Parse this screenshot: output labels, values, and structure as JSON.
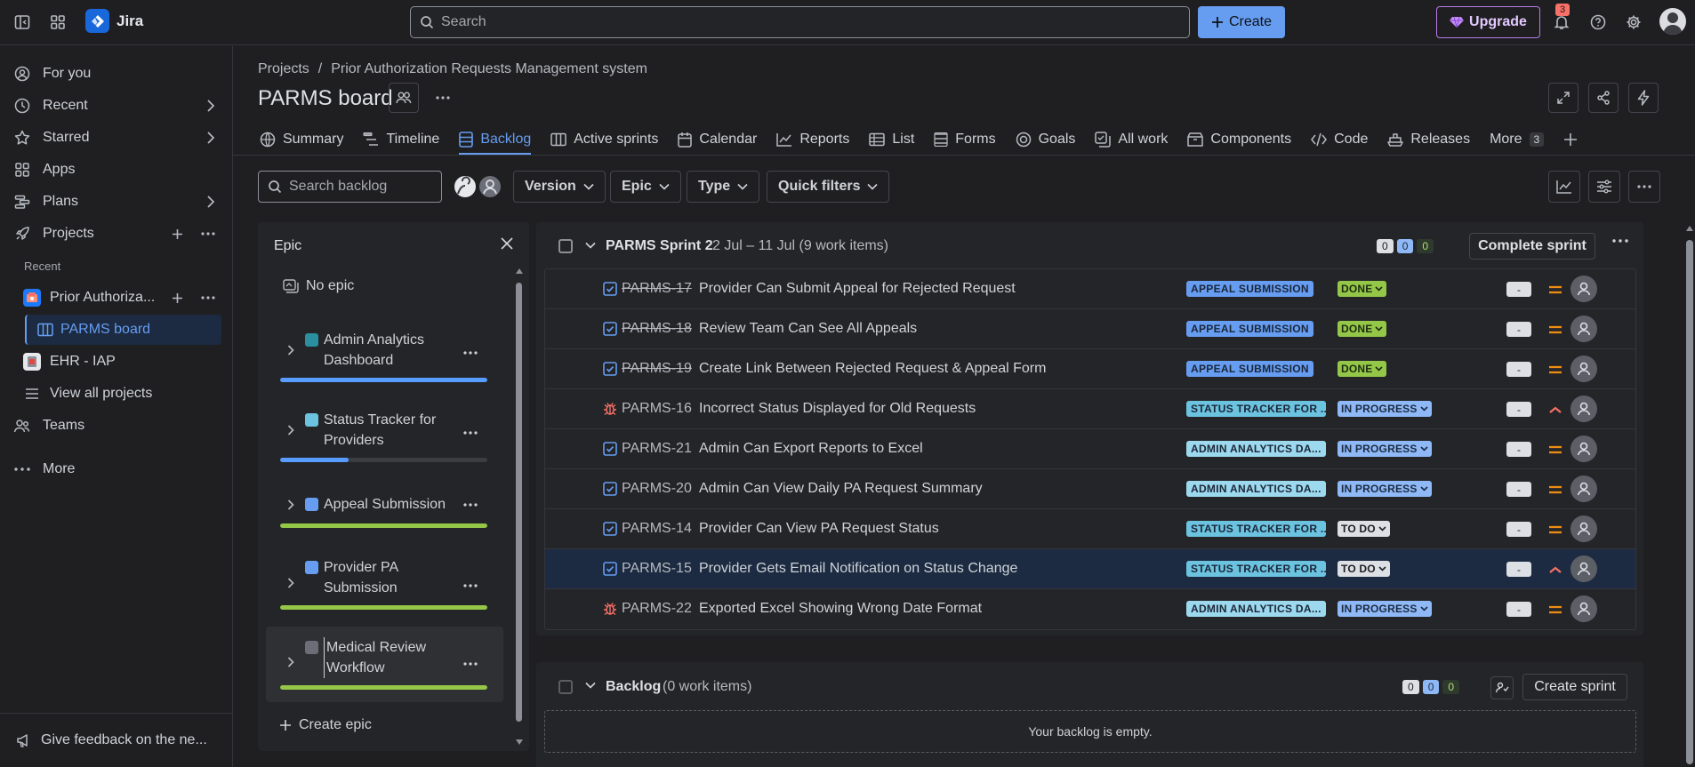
{
  "topbar": {
    "app_name": "Jira",
    "search_placeholder": "Search",
    "create_label": "Create",
    "upgrade_label": "Upgrade",
    "notification_count": "3"
  },
  "sidebar": {
    "items": [
      {
        "label": "For you",
        "icon": "user-circle-icon"
      },
      {
        "label": "Recent",
        "icon": "clock-icon"
      },
      {
        "label": "Starred",
        "icon": "star-icon"
      },
      {
        "label": "Apps",
        "icon": "apps-icon"
      },
      {
        "label": "Plans",
        "icon": "plans-icon"
      },
      {
        "label": "Projects",
        "icon": "rocket-icon"
      }
    ],
    "recent_label": "Recent",
    "projects": [
      {
        "label": "Prior Authoriza...",
        "color": "#4bce97"
      },
      {
        "label": "PARMS board"
      },
      {
        "label": "EHR - IAP",
        "color": "#e2483d"
      },
      {
        "label": "View all projects"
      }
    ],
    "teams_label": "Teams",
    "more_label": "More",
    "feedback_label": "Give feedback on the ne..."
  },
  "header": {
    "breadcrumb_projects": "Projects",
    "breadcrumb_sep": "/",
    "breadcrumb_project": "Prior Authorization Requests Management system",
    "title": "PARMS board"
  },
  "tabs": [
    {
      "label": "Summary",
      "icon": "globe-icon"
    },
    {
      "label": "Timeline",
      "icon": "timeline-icon"
    },
    {
      "label": "Backlog",
      "icon": "backlog-icon",
      "active": true
    },
    {
      "label": "Active sprints",
      "icon": "board-icon"
    },
    {
      "label": "Calendar",
      "icon": "calendar-icon"
    },
    {
      "label": "Reports",
      "icon": "chart-line-icon"
    },
    {
      "label": "List",
      "icon": "list-icon"
    },
    {
      "label": "Forms",
      "icon": "forms-icon"
    },
    {
      "label": "Goals",
      "icon": "goal-icon"
    },
    {
      "label": "All work",
      "icon": "all-work-icon"
    },
    {
      "label": "Components",
      "icon": "components-icon"
    },
    {
      "label": "Code",
      "icon": "code-icon"
    },
    {
      "label": "Releases",
      "icon": "ship-icon"
    },
    {
      "label": "More",
      "icon": "",
      "count": "3"
    }
  ],
  "filters": {
    "search_placeholder": "Search backlog",
    "version": "Version",
    "epic": "Epic",
    "type": "Type",
    "quick_filters": "Quick filters"
  },
  "epic_panel": {
    "title": "Epic",
    "no_epic": "No epic",
    "epics": [
      {
        "name": "Admin Analytics Dashboard",
        "color": "#2a8f9e",
        "progress": 1.0,
        "bar_color": "#579dff"
      },
      {
        "name": "Status Tracker for Providers",
        "color": "#6cc3e0",
        "progress": 0.33,
        "bar_color": "#579dff"
      },
      {
        "name": "Appeal Submission",
        "color": "#669df1",
        "progress": 1.0,
        "bar_color": "#94c748"
      },
      {
        "name": "Provider PA Submission",
        "color": "#669df1",
        "progress": 1.0,
        "bar_color": "#94c748"
      },
      {
        "name": "Medical Review Workflow",
        "color": "#6b6e76",
        "progress": 1.0,
        "bar_color": "#94c748"
      }
    ],
    "create_epic": "Create epic"
  },
  "sprint": {
    "name": "PARMS Sprint 2",
    "dates": "2 Jul – 11 Jul (9 work items)",
    "count_todo": "0",
    "count_progress": "0",
    "count_done": "0",
    "complete_label": "Complete sprint",
    "issues": [
      {
        "key": "PARMS-17",
        "summary": "Provider Can Submit Appeal for Rejected Request",
        "type": "story",
        "epic": "APPEAL SUBMISSION",
        "epic_color": "#669df1",
        "status": "DONE",
        "estimate": "-",
        "priority": "medium",
        "done": true
      },
      {
        "key": "PARMS-18",
        "summary": "Review Team Can See All Appeals",
        "type": "story",
        "epic": "APPEAL SUBMISSION",
        "epic_color": "#669df1",
        "status": "DONE",
        "estimate": "-",
        "priority": "medium",
        "done": true
      },
      {
        "key": "PARMS-19",
        "summary": "Create Link Between Rejected Request & Appeal Form",
        "type": "story",
        "epic": "APPEAL SUBMISSION",
        "epic_color": "#669df1",
        "status": "DONE",
        "estimate": "-",
        "priority": "medium",
        "done": true
      },
      {
        "key": "PARMS-16",
        "summary": "Incorrect Status Displayed for Old Requests",
        "type": "bug",
        "epic": "STATUS TRACKER FOR ...",
        "epic_color": "#6cc3e0",
        "status": "IN PROGRESS",
        "estimate": "-",
        "priority": "high",
        "done": false
      },
      {
        "key": "PARMS-21",
        "summary": "Admin Can Export Reports to Excel",
        "type": "story",
        "epic": "ADMIN ANALYTICS DA...",
        "epic_color": "#9dd9ee",
        "status": "IN PROGRESS",
        "estimate": "-",
        "priority": "medium",
        "done": false
      },
      {
        "key": "PARMS-20",
        "summary": "Admin Can View Daily PA Request Summary",
        "type": "story",
        "epic": "ADMIN ANALYTICS DA...",
        "epic_color": "#9dd9ee",
        "status": "IN PROGRESS",
        "estimate": "-",
        "priority": "medium",
        "done": false
      },
      {
        "key": "PARMS-14",
        "summary": "Provider Can View PA Request Status",
        "type": "story",
        "epic": "STATUS TRACKER FOR ...",
        "epic_color": "#6cc3e0",
        "status": "TO DO",
        "estimate": "-",
        "priority": "medium",
        "done": false
      },
      {
        "key": "PARMS-15",
        "summary": "Provider Gets Email Notification on Status Change",
        "type": "story",
        "epic": "STATUS TRACKER FOR ...",
        "epic_color": "#6cc3e0",
        "status": "TO DO",
        "estimate": "-",
        "priority": "high",
        "done": false,
        "selected": true
      },
      {
        "key": "PARMS-22",
        "summary": "Exported Excel Showing Wrong Date Format",
        "type": "bug",
        "epic": "ADMIN ANALYTICS DA...",
        "epic_color": "#9dd9ee",
        "status": "IN PROGRESS",
        "estimate": "-",
        "priority": "medium",
        "done": false
      }
    ]
  },
  "backlog": {
    "title": "Backlog",
    "count": "(0 work items)",
    "count_todo": "0",
    "count_progress": "0",
    "count_done": "0",
    "create_sprint": "Create sprint",
    "empty_text": "Your backlog is empty."
  },
  "colors": {
    "accent": "#669df1",
    "upgrade": "#b47be8",
    "priority_medium": "#f18d13",
    "priority_high": "#f87168",
    "bug": "#f87168"
  }
}
